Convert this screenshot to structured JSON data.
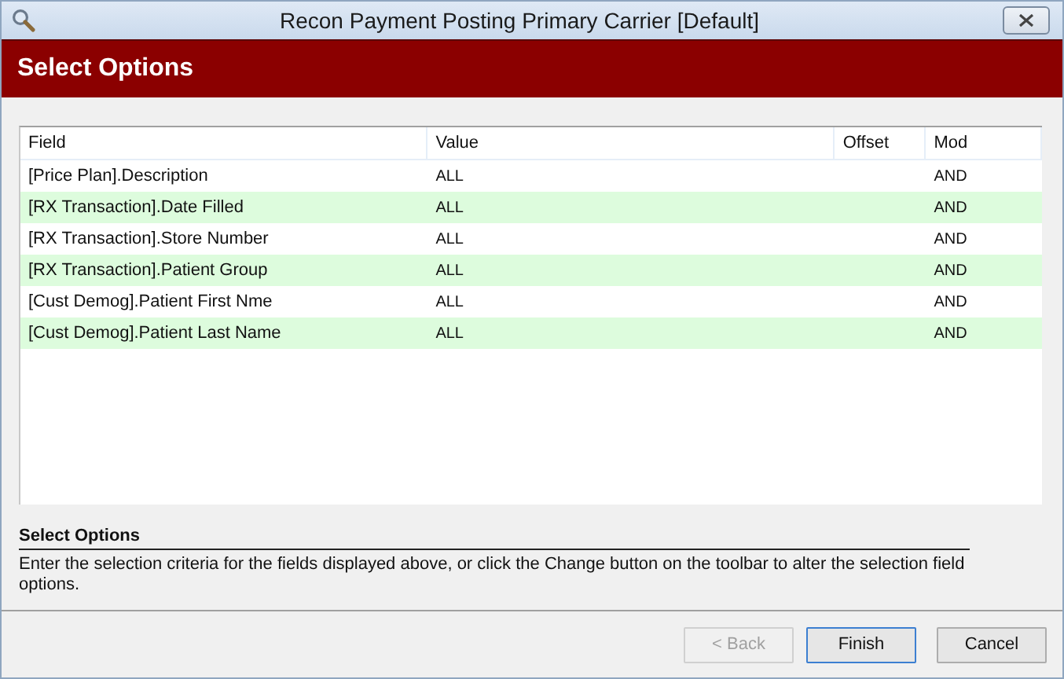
{
  "window": {
    "title": "Recon Payment Posting Primary Carrier [Default]"
  },
  "header": {
    "title": "Select Options"
  },
  "table": {
    "columns": [
      "Field",
      "Value",
      "Offset",
      "Mod"
    ],
    "rows": [
      {
        "cells": [
          "[Price Plan].Description",
          "ALL",
          "",
          "AND"
        ]
      },
      {
        "cells": [
          "[RX Transaction].Date Filled",
          "ALL",
          "",
          "AND"
        ]
      },
      {
        "cells": [
          "[RX Transaction].Store Number",
          "ALL",
          "",
          "AND"
        ]
      },
      {
        "cells": [
          "[RX Transaction].Patient Group",
          "ALL",
          "",
          "AND"
        ]
      },
      {
        "cells": [
          "[Cust Demog].Patient First Nme",
          "ALL",
          "",
          "AND"
        ]
      },
      {
        "cells": [
          "[Cust Demog].Patient Last Name",
          "ALL",
          "",
          "AND"
        ]
      }
    ]
  },
  "help": {
    "title": "Select Options",
    "text": "Enter the selection criteria for the fields displayed above, or click the Change button on the toolbar to alter the selection field options."
  },
  "buttons": [
    {
      "label": "< Back",
      "disabled": true,
      "focused": false
    },
    {
      "label": "Finish",
      "disabled": false,
      "focused": true
    },
    {
      "label": "Cancel",
      "disabled": false,
      "focused": false
    }
  ]
}
